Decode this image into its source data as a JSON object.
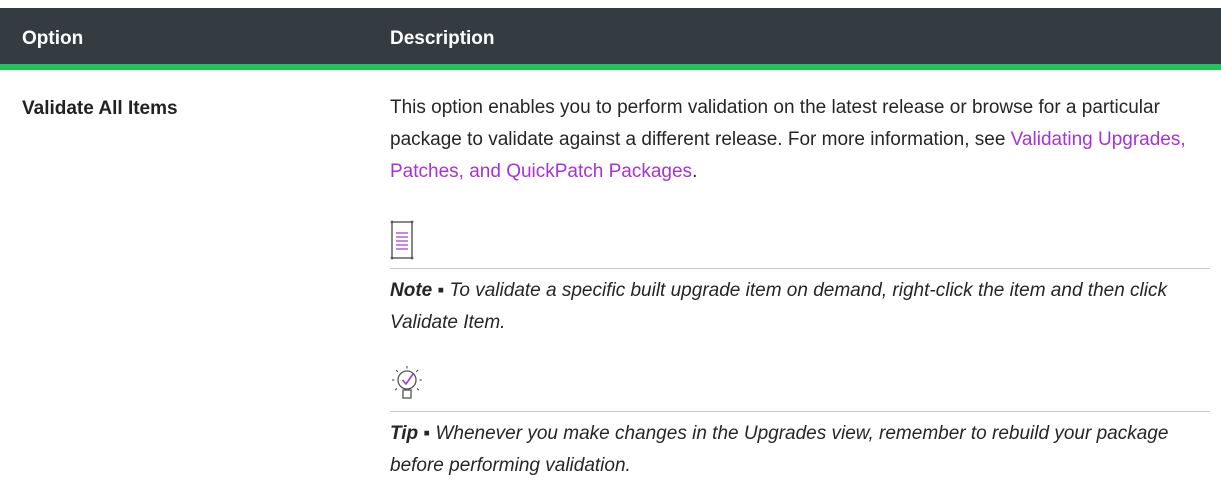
{
  "table": {
    "headers": {
      "option": "Option",
      "description": "Description"
    },
    "header_color": "#343c42",
    "accent_color": "#22c35a",
    "rows": [
      {
        "option": "Validate All Items",
        "description_prefix": "This option enables you to perform validation on the latest release or browse for a particular package to validate against a different release. For more information, see ",
        "link_text": "Validating Upgrades, Patches, and QuickPatch Packages",
        "description_suffix": ".",
        "note_icon": "note-icon",
        "note_label": "Note",
        "note_separator": " ▪ ",
        "note_text": "To validate a specific built upgrade item on demand, right-click the item and then click Validate Item.",
        "tip_icon": "tip-lightbulb-icon",
        "tip_label": "Tip",
        "tip_separator": " ▪ ",
        "tip_text": "Whenever you make changes in the Upgrades view, remember to rebuild your package before performing validation."
      }
    ]
  },
  "link_color": "#a733d6"
}
